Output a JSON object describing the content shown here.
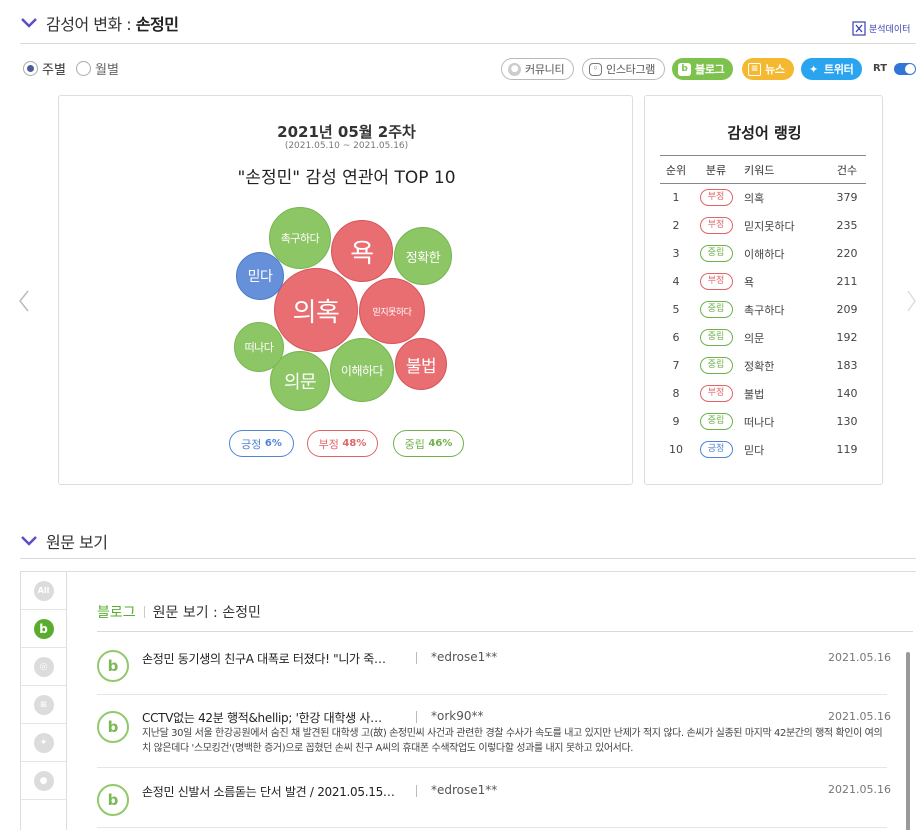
{
  "header": {
    "title_prefix": "감성어 변화 : ",
    "title_keyword": "손정민",
    "download_label": "분석데이터"
  },
  "period": {
    "weekly_label": "주별",
    "monthly_label": "월별",
    "selected": "주별"
  },
  "channels": {
    "community": "커뮤니티",
    "instagram": "인스타그램",
    "blog": "블로그",
    "news": "뉴스",
    "twitter": "트위터",
    "rt_label": "RT"
  },
  "colors": {
    "negative": "#e86e71",
    "neutral": "#8cc665",
    "positive": "#6690d9",
    "accent": "#4a5c9a"
  },
  "chart_data": {
    "type": "bubble",
    "week_title": "2021년 05월 2주차",
    "date_range": "(2021.05.10 ~ 2021.05.16)",
    "title": "\"손정민\" 감성 연관어 TOP 10",
    "bubbles": [
      {
        "label": "의혹",
        "sentiment": "부정",
        "size": 379
      },
      {
        "label": "믿지못하다",
        "sentiment": "부정",
        "size": 235
      },
      {
        "label": "이해하다",
        "sentiment": "중립",
        "size": 220
      },
      {
        "label": "욕",
        "sentiment": "부정",
        "size": 211
      },
      {
        "label": "촉구하다",
        "sentiment": "중립",
        "size": 209
      },
      {
        "label": "의문",
        "sentiment": "중립",
        "size": 192
      },
      {
        "label": "정확한",
        "sentiment": "중립",
        "size": 183
      },
      {
        "label": "불법",
        "sentiment": "부정",
        "size": 140
      },
      {
        "label": "떠나다",
        "sentiment": "중립",
        "size": 130
      },
      {
        "label": "믿다",
        "sentiment": "긍정",
        "size": 119
      }
    ],
    "legend": [
      {
        "label": "긍정",
        "value": "6%"
      },
      {
        "label": "부정",
        "value": "48%"
      },
      {
        "label": "중립",
        "value": "46%"
      }
    ]
  },
  "ranking": {
    "title": "감성어 랭킹",
    "headers": [
      "순위",
      "분류",
      "키워드",
      "건수"
    ],
    "rows": [
      {
        "rank": "1",
        "type": "부정",
        "keyword": "의혹",
        "count": "379"
      },
      {
        "rank": "2",
        "type": "부정",
        "keyword": "믿지못하다",
        "count": "235"
      },
      {
        "rank": "3",
        "type": "중립",
        "keyword": "이해하다",
        "count": "220"
      },
      {
        "rank": "4",
        "type": "부정",
        "keyword": "욕",
        "count": "211"
      },
      {
        "rank": "5",
        "type": "중립",
        "keyword": "촉구하다",
        "count": "209"
      },
      {
        "rank": "6",
        "type": "중립",
        "keyword": "의문",
        "count": "192"
      },
      {
        "rank": "7",
        "type": "중립",
        "keyword": "정확한",
        "count": "183"
      },
      {
        "rank": "8",
        "type": "부정",
        "keyword": "불법",
        "count": "140"
      },
      {
        "rank": "9",
        "type": "중립",
        "keyword": "떠나다",
        "count": "130"
      },
      {
        "rank": "10",
        "type": "긍정",
        "keyword": "믿다",
        "count": "119"
      }
    ]
  },
  "original": {
    "section_title": "원문 보기",
    "side_all": "All",
    "tab_label": "블로그",
    "view_title": "원문 보기 : 손정민",
    "posts": [
      {
        "title": "손정민 동기생의 친구A 대폭로 터졌다! \"니가 죽…",
        "author": "*edrose1**",
        "date": "2021.05.16",
        "body": ""
      },
      {
        "title": "CCTV없는 42분 행적&hellip; '한강 대학생 사…",
        "author": "*ork90**",
        "date": "2021.05.16",
        "body": "지난달 30일 서울 한강공원에서 숨진 채 발견된 대학생 고(故) 손정민씨 사건과 관련한 경찰 수사가 속도를 내고 있지만 난제가 적지 않다. 손씨가 실종된 마지막 42분간의 행적 확인이 여의치 않은데다 '스모킹건'(명백한 증거)으로 꼽혔던 손씨 친구 A씨의 휴대폰 수색작업도 이렇다할 성과를 내지 못하고 있어서다."
      },
      {
        "title": "손정민 신발서 소름돋는 단서 발견 / 2021.05.15…",
        "author": "*edrose1**",
        "date": "2021.05.16",
        "body": ""
      }
    ]
  }
}
